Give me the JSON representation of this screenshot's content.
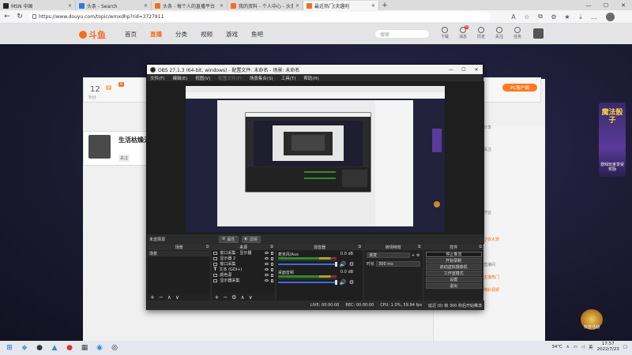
{
  "browser": {
    "tabs": [
      {
        "label": "MSN 中国",
        "color": "#222222"
      },
      {
        "label": "头条 - Search",
        "color": "#2a7ae2"
      },
      {
        "label": "头条 - 每个人的直播平台",
        "color": "#f36e21"
      },
      {
        "label": "我的资料 - 个人中心 - 头条",
        "color": "#f36e21"
      },
      {
        "label": "最近热门(夫趣利",
        "color": "#f36e21"
      }
    ],
    "url": "https://www.douyu.com/topic/wmxdhp?rid=3727911",
    "window_controls": [
      "—",
      "☐",
      "✕"
    ]
  },
  "site": {
    "logo": "斗鱼",
    "nav": [
      "首页",
      "直播",
      "分类",
      "视频",
      "游戏",
      "鱼吧"
    ],
    "active_nav": "直播",
    "search_placeholder": "搜索",
    "icons": [
      "下载",
      "消息",
      "历史",
      "关注",
      "任务"
    ],
    "message_badge": "6",
    "pc_button": "PC客户端",
    "counter": "12",
    "counter_sub": "粉丝",
    "chip1": "3",
    "chip2": "6",
    "anchor_name": "生活枯燥无",
    "anchor_follow": "关注",
    "right_lines": [
      "分享",
      "关注",
      "作业",
      "直播间"
    ],
    "right_orange": [
      "卫衣大赏",
      "主播热门",
      "精彩视频"
    ],
    "ad_title": "魔法骰子",
    "ad_sub": "游戏玩家享受奖励",
    "badge_text": "抖音活动"
  },
  "obs": {
    "title": "OBS 27.1.3 (64-bit, windows) - 配置文件: 未命名 - 场景: 未命名",
    "menu": [
      "文件(F)",
      "编辑(E)",
      "视图(V)",
      "配置文件(P)",
      "场景集合(S)",
      "工具(T)",
      "帮助(H)"
    ],
    "no_source": "未选择源",
    "props_btn": "属性",
    "filter_btn": "滤镜",
    "docks": {
      "scenes": {
        "title": "场景",
        "items": [
          "场景"
        ]
      },
      "sources": {
        "title": "来源",
        "items": [
          "窗口采集 - 显示器",
          "显示器 2",
          "窗口采集",
          "文本 (GDI+)",
          "颜色源",
          "显示器采集"
        ]
      },
      "mixer": {
        "title": "混音器",
        "channels": [
          {
            "name": "麦克风/Aux",
            "db": "0.0 dB"
          },
          {
            "name": "桌面音频",
            "db": "0.0 dB"
          }
        ]
      },
      "transitions": {
        "title": "转场特效",
        "type": "渐变",
        "duration_label": "时长",
        "duration": "300 ms"
      },
      "controls": {
        "title": "控件",
        "buttons": [
          "停止推流",
          "开始录制",
          "启动虚拟摄像机",
          "工作室模式",
          "设置",
          "退出"
        ]
      }
    },
    "status": {
      "live": "LIVE: 00:00:00",
      "rec": "REC: 00:00:00",
      "cpu": "CPU: 1.0%, 59.94 fps",
      "net": "延迟 (0) 帧 300 秒后开始推流"
    }
  },
  "taskbar": {
    "time": "17:57",
    "date": "2022/7/23",
    "lang": "英",
    "temp": "34℃"
  },
  "colors": {
    "accent": "#f36e21",
    "obs_bg": "#2b2b2b",
    "obs_selected": "#3a6ed8"
  }
}
